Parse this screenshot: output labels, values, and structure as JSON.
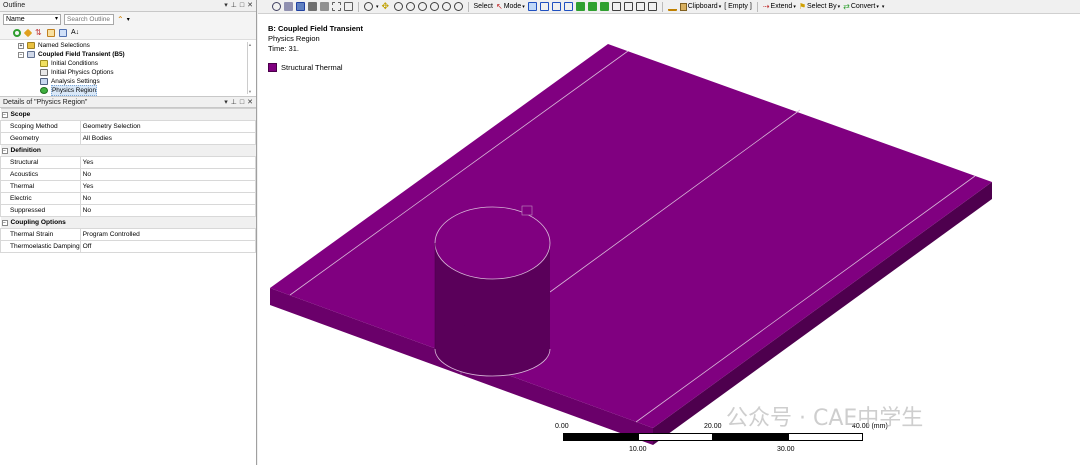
{
  "outline": {
    "title": "Outline",
    "controls": [
      "▾",
      "⊥",
      "□",
      "✕"
    ],
    "name_select": "Name",
    "search_placeholder": "Search Outline",
    "tree": [
      {
        "label": "Named Selections",
        "bold": false,
        "indent": 1,
        "expander": "+"
      },
      {
        "label": "Coupled Field Transient (B5)",
        "bold": true,
        "indent": 1,
        "expander": "−"
      },
      {
        "label": "Initial Conditions",
        "bold": false,
        "indent": 2
      },
      {
        "label": "Initial Physics Options",
        "bold": false,
        "indent": 2
      },
      {
        "label": "Analysis Settings",
        "bold": false,
        "indent": 2
      },
      {
        "label": "Physics Region",
        "bold": false,
        "indent": 2,
        "selected": true
      }
    ]
  },
  "details": {
    "title": "Details of \"Physics Region\"",
    "controls": [
      "▾",
      "⊥",
      "□",
      "✕"
    ],
    "sections": [
      {
        "name": "Scope",
        "rows": [
          {
            "key": "Scoping Method",
            "value": "Geometry Selection"
          },
          {
            "key": "Geometry",
            "value": "All Bodies"
          }
        ]
      },
      {
        "name": "Definition",
        "rows": [
          {
            "key": "Structural",
            "value": "Yes"
          },
          {
            "key": "Acoustics",
            "value": "No"
          },
          {
            "key": "Thermal",
            "value": "Yes"
          },
          {
            "key": "Electric",
            "value": "No"
          },
          {
            "key": "Suppressed",
            "value": "No"
          }
        ]
      },
      {
        "name": "Coupling Options",
        "rows": [
          {
            "key": "Thermal Strain",
            "value": "Program Controlled"
          },
          {
            "key": "Thermoelastic Damping",
            "value": "Off"
          }
        ]
      }
    ]
  },
  "toolbar": {
    "select_label": "Select",
    "mode_label": "Mode",
    "clipboard_label": "Clipboard",
    "empty_label": "[ Empty ]",
    "extend_label": "Extend",
    "select_by_label": "Select By",
    "convert_label": "Convert"
  },
  "viewport": {
    "title": "B: Coupled Field Transient",
    "subtitle": "Physics Region",
    "time": "Time: 31.",
    "legend_label": "Structural Thermal",
    "legend_color": "#800080",
    "scale_labels": {
      "l0": "0.00",
      "l10": "10.00",
      "l20": "20.00",
      "l30": "30.00",
      "l40": "40.00 (mm)"
    }
  },
  "watermark": "公众号 · CAE中学生",
  "colors": {
    "body_top": "#800080",
    "body_front": "#6a006a",
    "body_side": "#4e004e",
    "accent": "#0078d7"
  }
}
